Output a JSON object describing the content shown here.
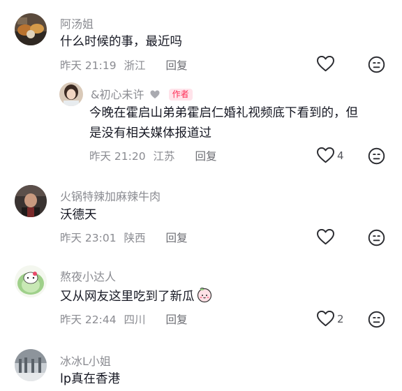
{
  "comments": [
    {
      "username": "阿汤姐",
      "text": "什么时候的事，最近吗",
      "time": "昨天 21:19",
      "location": "浙江",
      "reply_label": "回复",
      "like_count": ""
    },
    {
      "username": "&初心未许",
      "badge": "作者",
      "text_line1": "今晚在霍启山弟弟霍启仁婚礼视频底下看到的，但",
      "text_line2": "是没有相关媒体报道过",
      "time": "昨天 21:20",
      "location": "江苏",
      "reply_label": "回复",
      "like_count": "4"
    },
    {
      "username": "火锅特辣加麻辣牛肉",
      "text": "沃德天",
      "time": "昨天 23:01",
      "location": "陕西",
      "reply_label": "回复",
      "like_count": ""
    },
    {
      "username": "熬夜小达人",
      "text": "又从网友这里吃到了新瓜",
      "time": "昨天 22:44",
      "location": "四川",
      "reply_label": "回复",
      "like_count": "2"
    },
    {
      "username": "冰冰L小姐",
      "text": "lp真在香港"
    }
  ],
  "icons": {
    "like": "heart-outline-icon",
    "dislike": "neutral-face-icon"
  },
  "colors": {
    "username": "#8a8b91",
    "meta": "#8a8b91",
    "author_badge_bg": "#ffe3ea",
    "author_badge_text": "#fe2c55"
  }
}
